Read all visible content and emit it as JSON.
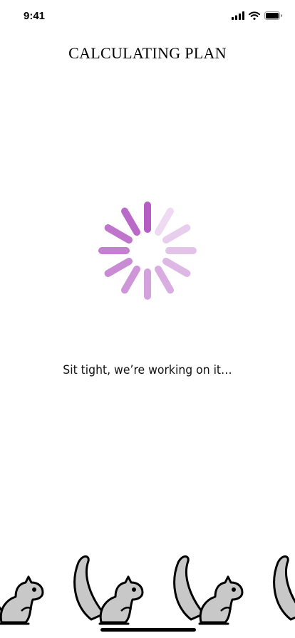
{
  "status_bar": {
    "time": "9:41",
    "icons": [
      "cellular-signal-icon",
      "wifi-icon",
      "battery-icon"
    ]
  },
  "screen": {
    "title": "CALCULATING PLAN",
    "message": "Sit tight, we’re working on it…"
  },
  "spinner": {
    "accent_color": "#b45ec4",
    "spoke_count": 12
  },
  "decor": {
    "squirrel_fill": "#c8c8c8",
    "squirrel_outline": "#000000"
  }
}
